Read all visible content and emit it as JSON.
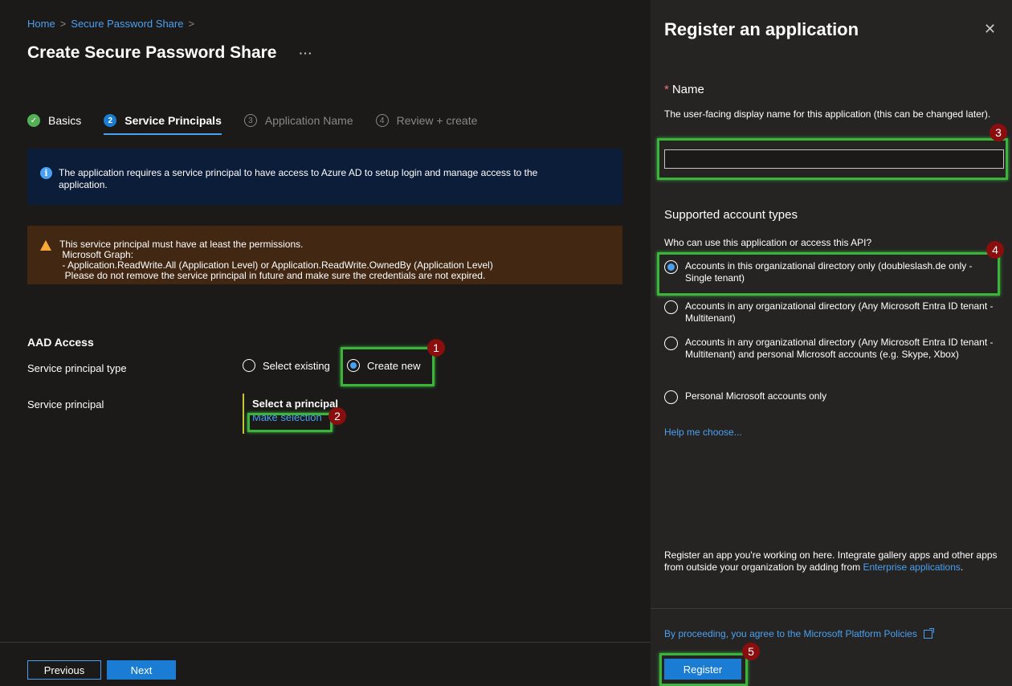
{
  "breadcrumb": {
    "home": "Home",
    "sep": ">",
    "item": "Secure Password Share",
    "trail_sep": ">"
  },
  "page": {
    "title": "Create Secure Password Share",
    "more": "···"
  },
  "steps": [
    {
      "num": "✓",
      "label": "Basics",
      "state": "done"
    },
    {
      "num": "2",
      "label": "Service Principals",
      "state": "active"
    },
    {
      "num": "3",
      "label": "Application Name",
      "state": "todo"
    },
    {
      "num": "4",
      "label": "Review + create",
      "state": "todo"
    }
  ],
  "info": {
    "icon": "i",
    "line1": "The application requires a service principal to have access to Azure AD to setup login and manage access to the",
    "line2": "application."
  },
  "warning": {
    "lines": [
      "This service principal must have at least the permissions.",
      " Microsoft Graph:",
      " - Application.ReadWrite.All (Application Level) or Application.ReadWrite.OwnedBy (Application Level)",
      "  Please do not remove the service principal in future and make sure the credentials are not expired."
    ]
  },
  "aad": {
    "title": "AAD Access",
    "type_label": "Service principal type",
    "sp_label": "Service principal",
    "select_existing": "Select existing",
    "create_new": "Create new",
    "select_principal": "Select a principal",
    "make_selection": "Make selection"
  },
  "nav": {
    "previous": "Previous",
    "next": "Next"
  },
  "panel": {
    "title": "Register an application",
    "close": "✕",
    "name_required": "*",
    "name_label": "Name",
    "name_desc": "The user-facing display name for this application (this can be changed later).",
    "name_value": "",
    "sat_title": "Supported account types",
    "sat_question": "Who can use this application or access this API?",
    "options": [
      "Accounts in this organizational directory only (doubleslash.de only - Single tenant)",
      "Accounts in any organizational directory (Any Microsoft Entra ID tenant - Multitenant)",
      "Accounts in any organizational directory (Any Microsoft Entra ID tenant - Multitenant) and personal Microsoft accounts (e.g. Skype, Xbox)",
      "Personal Microsoft accounts only"
    ],
    "help": "Help me choose...",
    "footer_text": "Register an app you're working on here. Integrate gallery apps and other apps from outside your organization by adding from",
    "footer_link": "Enterprise applications",
    "footer_end": ".",
    "agree": "By proceeding, you agree to the Microsoft Platform Policies",
    "register": "Register"
  },
  "badges": [
    "1",
    "2",
    "3",
    "4",
    "5"
  ],
  "colors": {
    "accent": "#1b7cd4",
    "link": "#4aa0f0",
    "highlight": "#3cb43c",
    "badge": "#8b0e0e"
  }
}
